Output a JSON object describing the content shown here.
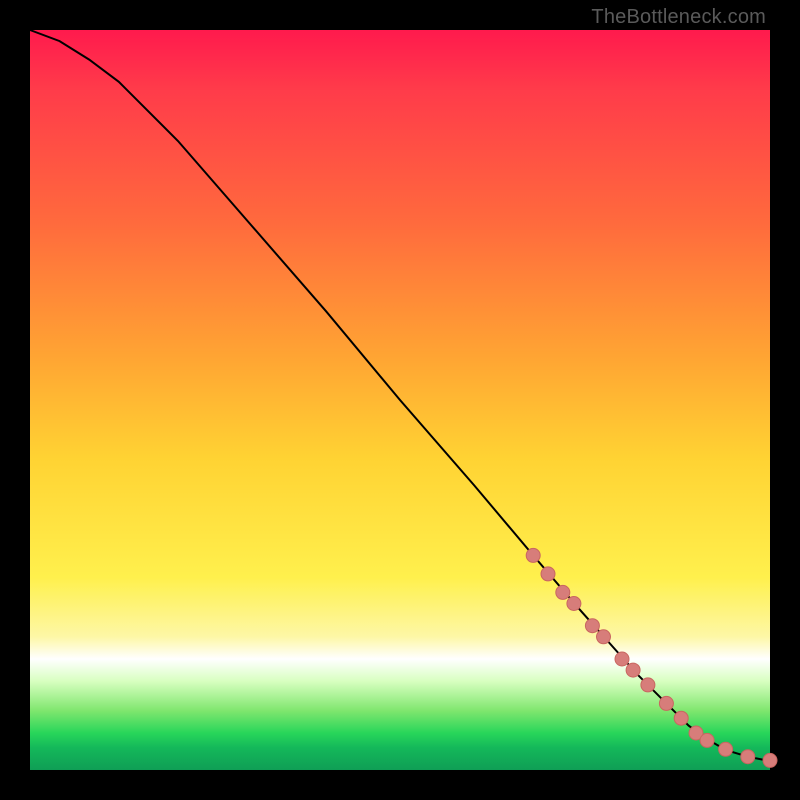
{
  "attribution": "TheBottleneck.com",
  "colors": {
    "curve_stroke": "#000000",
    "marker_fill": "#d77d7a",
    "marker_stroke": "#c96660"
  },
  "chart_data": {
    "type": "line",
    "title": "",
    "xlabel": "",
    "ylabel": "",
    "xlim": [
      0,
      100
    ],
    "ylim": [
      0,
      100
    ],
    "grid": false,
    "legend": false,
    "series": [
      {
        "name": "curve",
        "x": [
          0,
          4,
          8,
          12,
          20,
          30,
          40,
          50,
          60,
          68,
          74,
          78,
          82,
          86,
          89,
          91,
          93,
          95,
          97,
          99,
          100
        ],
        "y": [
          100,
          98.5,
          96,
          93,
          85,
          73.5,
          62,
          50,
          38.5,
          29,
          22,
          17.5,
          13,
          9,
          6,
          4.5,
          3.3,
          2.4,
          1.8,
          1.4,
          1.3
        ]
      }
    ],
    "markers": [
      {
        "x": 68,
        "y": 29
      },
      {
        "x": 70,
        "y": 26.5
      },
      {
        "x": 72,
        "y": 24
      },
      {
        "x": 73.5,
        "y": 22.5
      },
      {
        "x": 76,
        "y": 19.5
      },
      {
        "x": 77.5,
        "y": 18
      },
      {
        "x": 80,
        "y": 15
      },
      {
        "x": 81.5,
        "y": 13.5
      },
      {
        "x": 83.5,
        "y": 11.5
      },
      {
        "x": 86,
        "y": 9
      },
      {
        "x": 88,
        "y": 7
      },
      {
        "x": 90,
        "y": 5
      },
      {
        "x": 91.5,
        "y": 4
      },
      {
        "x": 94,
        "y": 2.8
      },
      {
        "x": 97,
        "y": 1.8
      },
      {
        "x": 100,
        "y": 1.3
      }
    ]
  }
}
